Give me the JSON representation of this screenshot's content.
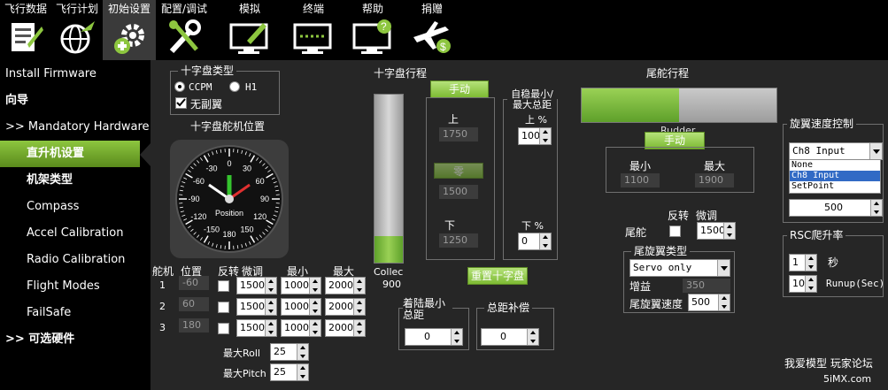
{
  "menu": [
    {
      "label": "飞行数据",
      "icon": "flight-data-icon"
    },
    {
      "label": "飞行计划",
      "icon": "flight-plan-icon"
    },
    {
      "label": "初始设置",
      "icon": "initial-setup-icon"
    },
    {
      "label": "配置/调试",
      "icon": "config-tuning-icon"
    },
    {
      "label": "模拟",
      "icon": "simulation-icon"
    },
    {
      "label": "终端",
      "icon": "terminal-icon"
    },
    {
      "label": "帮助",
      "icon": "help-icon"
    },
    {
      "label": "捐赠",
      "icon": "donate-icon"
    }
  ],
  "sidebar": [
    {
      "label": "Install Firmware"
    },
    {
      "label": "向导"
    },
    {
      "label": ">> Mandatory Hardware"
    },
    {
      "label": "直升机设置"
    },
    {
      "label": "机架类型"
    },
    {
      "label": "Compass"
    },
    {
      "label": "Accel Calibration"
    },
    {
      "label": "Radio Calibration"
    },
    {
      "label": "Flight Modes"
    },
    {
      "label": "FailSafe"
    },
    {
      "label": ">> 可选硬件"
    }
  ],
  "swash_type": {
    "title": "十字盘类型",
    "ccpm": "CCPM",
    "h1": "H1",
    "no_servo": "无副翼"
  },
  "swash_servo_pos": {
    "title": "十字盘舵机位置",
    "dial_label": "Position",
    "dial_ticks": [
      "0",
      "30",
      "60",
      "90",
      "120",
      "150",
      "180",
      "-150",
      "-120",
      "-90",
      "-60",
      "-30"
    ]
  },
  "servo_table": {
    "headers": [
      "舵机",
      "位置",
      "反转",
      "微调",
      "最小",
      "最大"
    ],
    "rows": [
      {
        "num": "1",
        "pos": "-60",
        "trim": "1500",
        "min": "1000",
        "max": "2000"
      },
      {
        "num": "2",
        "pos": "60",
        "trim": "1500",
        "min": "1000",
        "max": "2000"
      },
      {
        "num": "3",
        "pos": "180",
        "trim": "1500",
        "min": "1000",
        "max": "2000"
      }
    ],
    "max_roll_label": "最大Roll",
    "max_roll": "25",
    "max_pitch_label": "最大Pitch",
    "max_pitch": "25"
  },
  "swash_travel": {
    "title": "十字盘行程",
    "collec_label": "Collec",
    "collec_value": "900",
    "collec_level": 0.16,
    "manual": "手动",
    "top_label": "上",
    "top_value": "1750",
    "zero_label": "零",
    "zero_value": "1500",
    "bottom_label": "下",
    "bottom_value": "1250",
    "reset": "重置十字盘"
  },
  "stab_collective": {
    "title": "自稳最小/最大总距",
    "max_label": "上 %",
    "max_value": "100",
    "min_label": "下 %",
    "min_value": "0"
  },
  "land_collective": {
    "title": "着陆最小总距",
    "value": "0"
  },
  "collective_comp": {
    "title": "总距补偿",
    "value": "0"
  },
  "tail_travel": {
    "title": "尾舵行程",
    "rudder_label": "Rudder",
    "rudder_level": 0.5,
    "manual": "手动",
    "min_label": "最小",
    "min_value": "1100",
    "max_label": "最大",
    "max_value": "1900"
  },
  "tail": {
    "reverse_label": "反转",
    "trim_label": "微调",
    "tail_label": "尾舵",
    "trim_value": "1500"
  },
  "tail_type": {
    "title": "尾旋翼类型",
    "selected": "Servo only",
    "gain_label": "增益",
    "gain_value": "350",
    "speed_label": "尾旋翼速度",
    "speed_value": "500"
  },
  "rotor_speed": {
    "title": "旋翼速度控制",
    "selected": "Ch8 Input",
    "options": [
      "None",
      "Ch8 Input",
      "SetPoint"
    ],
    "setpoint_value": "500"
  },
  "rsc_ramp": {
    "title": "RSC爬升率",
    "sec_value": "1",
    "sec_label": "秒",
    "runup_value": "10",
    "runup_label": "Runup(Sec)"
  },
  "watermark": {
    "line1": "我爱模型 玩家论坛",
    "line2": "5iMX.com"
  },
  "colors": {
    "accent": "#8dc63f",
    "bar_green": "#7fc93a",
    "background": "#262626"
  }
}
